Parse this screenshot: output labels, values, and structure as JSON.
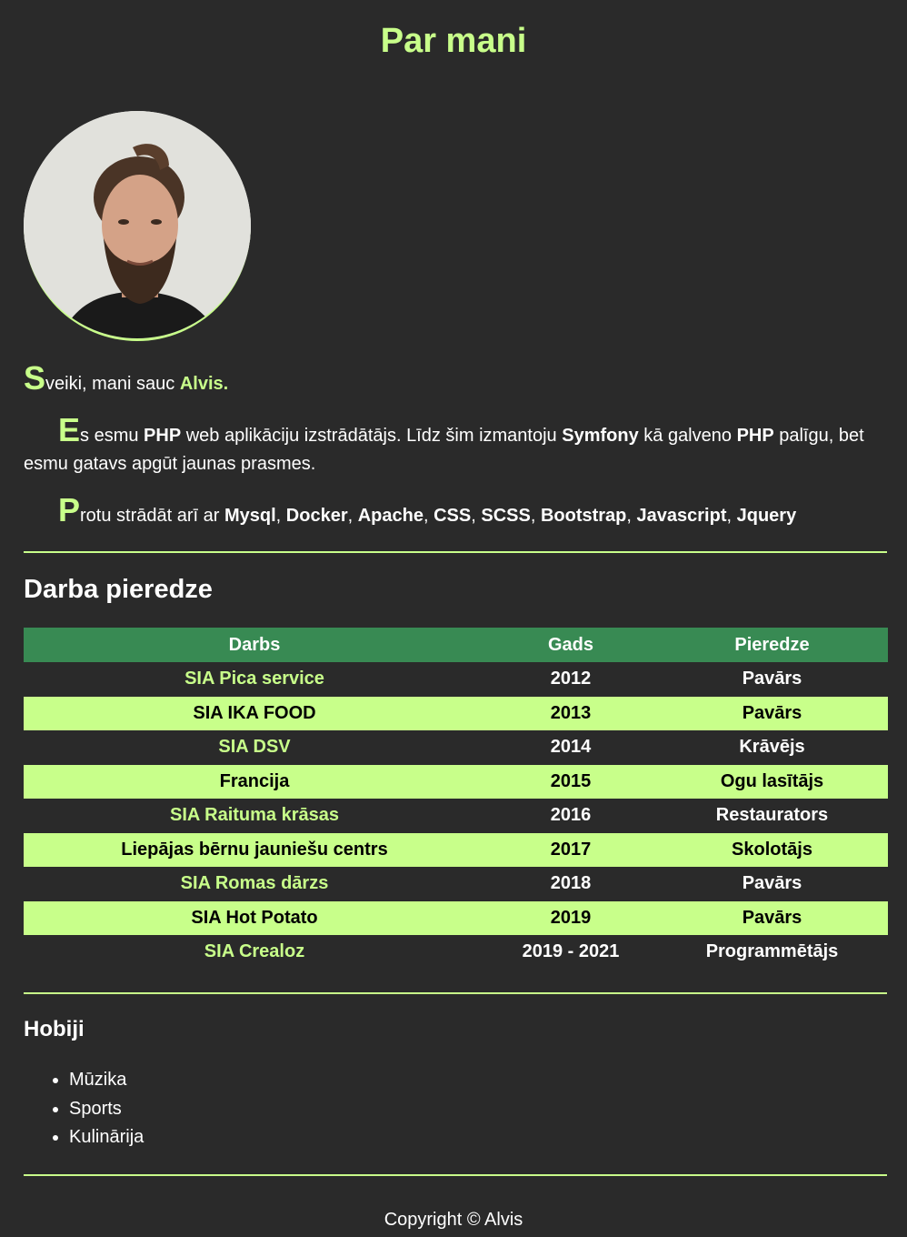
{
  "page": {
    "title": "Par mani"
  },
  "intro": {
    "greeting_cap": "S",
    "greeting_rest": "veiki, mani sauc ",
    "name": "Alvis.",
    "p2_cap": "E",
    "p2_a": "s esmu ",
    "p2_php1": "PHP",
    "p2_b": " web aplikāciju izstrādātājs. Līdz šim izmantoju ",
    "p2_symfony": "Symfony",
    "p2_c": " kā galveno ",
    "p2_php2": "PHP",
    "p2_d": " palīgu, bet esmu gatavs apgūt jaunas prasmes.",
    "p3_cap": "P",
    "p3_a": "rotu strādāt arī ar ",
    "skills": [
      "Mysql",
      "Docker",
      "Apache",
      "CSS",
      "SCSS",
      "Bootstrap",
      "Javascript",
      "Jquery"
    ],
    "separator": ", "
  },
  "work": {
    "heading": "Darba pieredze",
    "columns": [
      "Darbs",
      "Gads",
      "Pieredze"
    ],
    "rows": [
      [
        "SIA Pica service",
        "2012",
        "Pavārs"
      ],
      [
        "SIA IKA FOOD",
        "2013",
        "Pavārs"
      ],
      [
        "SIA DSV",
        "2014",
        "Krāvējs"
      ],
      [
        "Francija",
        "2015",
        "Ogu lasītājs"
      ],
      [
        "SIA Raituma krāsas",
        "2016",
        "Restaurators"
      ],
      [
        "Liepājas bērnu jauniešu centrs",
        "2017",
        "Skolotājs"
      ],
      [
        "SIA Romas dārzs",
        "2018",
        "Pavārs"
      ],
      [
        "SIA Hot Potato",
        "2019",
        "Pavārs"
      ],
      [
        "SIA Crealoz",
        "2019 - 2021",
        "Programmētājs"
      ]
    ]
  },
  "hobbies": {
    "heading": "Hobiji",
    "items": [
      "Mūzika",
      "Sports",
      "Kulinārija"
    ]
  },
  "footer": {
    "text": "Copyright © Alvis"
  },
  "colors": {
    "accent": "#c8ff8a",
    "header_green": "#388a53",
    "background": "#2a2a2a"
  }
}
